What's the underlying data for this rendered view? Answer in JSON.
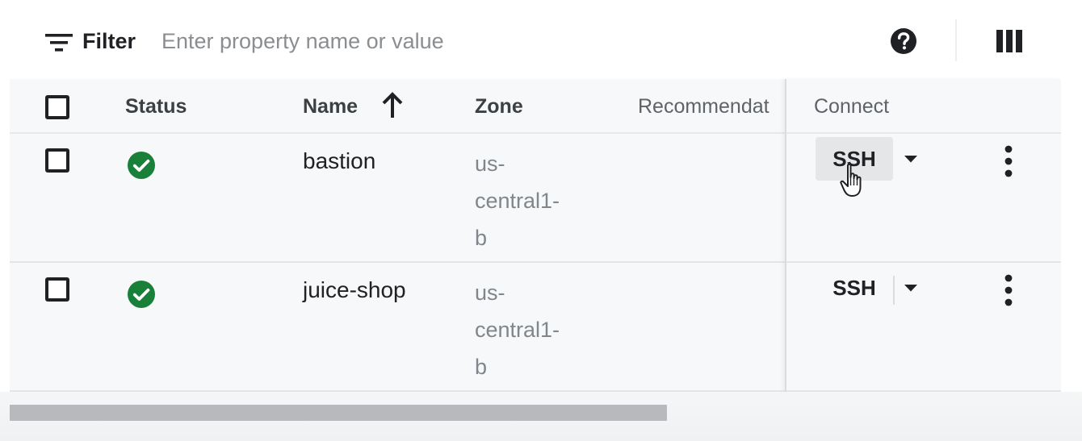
{
  "filter": {
    "label": "Filter",
    "placeholder": "Enter property name or value",
    "value": "",
    "icon": "filter-list-icon"
  },
  "toolbar": {
    "help_icon": "help-icon",
    "columns_icon": "column-display-icon"
  },
  "table": {
    "columns": {
      "status": "Status",
      "name": "Name",
      "zone": "Zone",
      "recommendation": "Recommendat",
      "connect": "Connect"
    },
    "sort": {
      "column": "name",
      "direction": "ascending",
      "icon": "arrow-up-icon"
    },
    "rows": [
      {
        "status": "running",
        "status_icon": "check-circle-icon",
        "name": "bastion",
        "zone_lines": [
          "us-",
          "central1-",
          "b"
        ],
        "recommendation": "",
        "connect_label": "SSH",
        "ssh_hovered": true
      },
      {
        "status": "running",
        "status_icon": "check-circle-icon",
        "name": "juice-shop",
        "zone_lines": [
          "us-",
          "central1-",
          "b"
        ],
        "recommendation": "",
        "connect_label": "SSH",
        "ssh_hovered": false
      }
    ]
  },
  "colors": {
    "status_ok": "#188038",
    "table_background": "#f7f8f9",
    "text_primary": "#202124",
    "text_secondary": "#80868b",
    "hover_background": "#e4e6e8"
  }
}
